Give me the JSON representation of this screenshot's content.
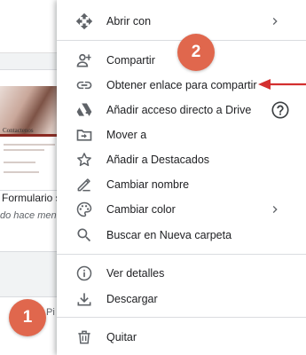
{
  "background": {
    "form_card_title": "Contactenos",
    "file_title": "Formulario si",
    "file_subtitle": "do hace meno",
    "bottom_partial_text": "Pi"
  },
  "context_menu": {
    "items": [
      {
        "label": "Abrir con",
        "icon": "move-arrows-icon",
        "has_submenu": true
      },
      {
        "label": "Compartir",
        "icon": "person-add-icon"
      },
      {
        "label": "Obtener enlace para compartir",
        "icon": "link-icon"
      },
      {
        "label": "Añadir acceso directo a Drive",
        "icon": "drive-shortcut-icon",
        "has_help": true
      },
      {
        "label": "Mover a",
        "icon": "move-to-folder-icon"
      },
      {
        "label": "Añadir a Destacados",
        "icon": "star-icon"
      },
      {
        "label": "Cambiar nombre",
        "icon": "pencil-icon"
      },
      {
        "label": "Cambiar color",
        "icon": "palette-icon",
        "has_submenu": true
      },
      {
        "label": "Buscar en Nueva carpeta",
        "icon": "search-icon"
      },
      {
        "label": "Ver detalles",
        "icon": "info-icon"
      },
      {
        "label": "Descargar",
        "icon": "download-icon"
      },
      {
        "label": "Quitar",
        "icon": "trash-icon"
      }
    ]
  },
  "annotations": {
    "step1": "1",
    "step2": "2",
    "badge_color": "#e0674d",
    "arrow_color": "#d32f2f"
  }
}
